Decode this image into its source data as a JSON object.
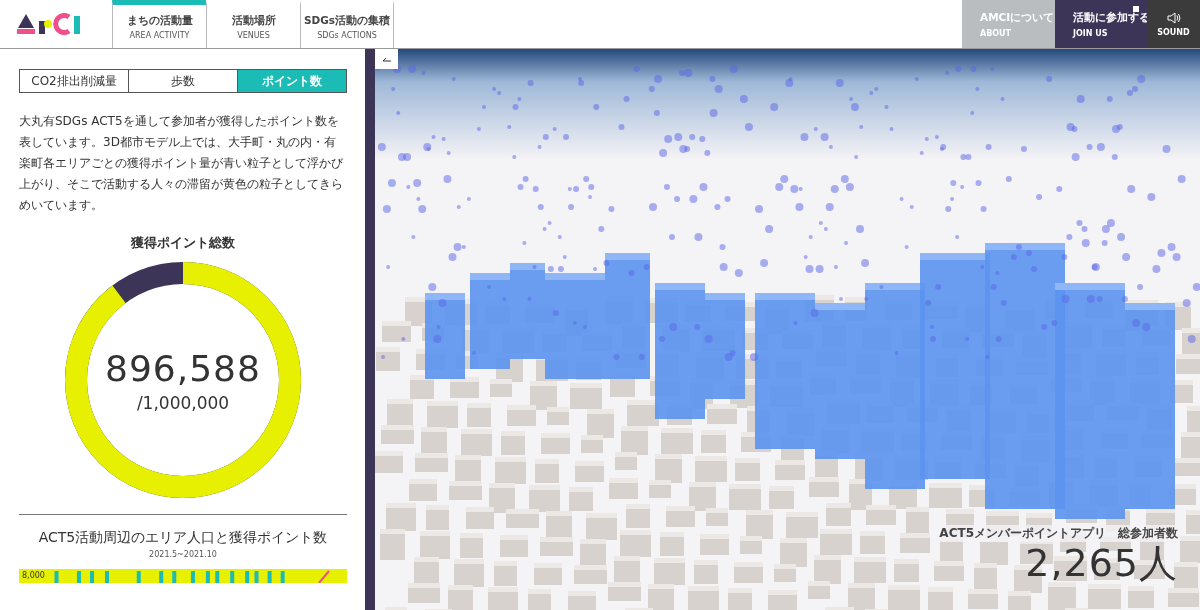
{
  "header": {
    "nav": [
      {
        "label": "まちの活動量",
        "sublabel": "AREA ACTIVITY",
        "selected": true
      },
      {
        "label": "活動場所",
        "sublabel": "VENUES",
        "selected": false
      },
      {
        "label": "SDGs活動の集積",
        "sublabel": "SDGs ACTIONS",
        "selected": false
      }
    ],
    "actions": [
      {
        "kind": "about",
        "label": "AMCIについて",
        "sublabel": "ABOUT"
      },
      {
        "kind": "join",
        "label": "活動に参加する",
        "sublabel": "JOIN US"
      },
      {
        "kind": "sound",
        "sublabel": "SOUND"
      }
    ]
  },
  "panel": {
    "tabs": [
      {
        "label": "CO2排出削減量",
        "selected": false
      },
      {
        "label": "歩数",
        "selected": false
      },
      {
        "label": "ポイント数",
        "selected": true
      }
    ],
    "description": "大丸有SDGs ACT5を通して参加者が獲得したポイント数を表しています。3D都市モデル上では、大手町・丸の内・有楽町各エリアごとの獲得ポイント量が青い粒子として浮かび上がり、そこで活動する人々の滞留が黄色の粒子としてきらめいています。",
    "total": {
      "title": "獲得ポイント総数",
      "value": "896,588",
      "goal": "/1,000,000",
      "level": 0.897
    },
    "area_chart": {
      "title": "ACT5活動周辺のエリア人口と獲得ポイント数",
      "period": "2021.5~2021.10",
      "tick": "8,000"
    }
  },
  "map": {
    "caption": "ACT5メンバーポイントアプリ",
    "caption_2": "総参加者数",
    "count": "2,265人"
  }
}
